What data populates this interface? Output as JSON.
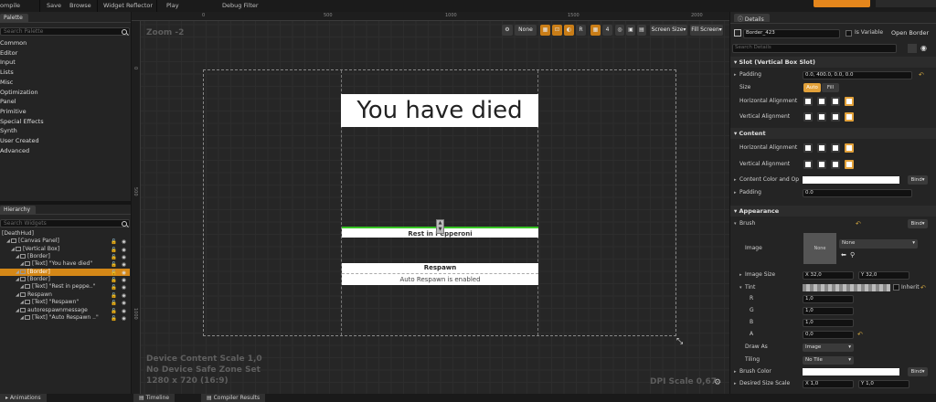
{
  "toolbar": {
    "items": [
      "ompile",
      "Save",
      "Browse",
      "Widget Reflector",
      "Play",
      "Debug Filter"
    ]
  },
  "palette": {
    "tab": "Palette",
    "search_placeholder": "Search Palette",
    "categories": [
      "Common",
      "Editor",
      "Input",
      "Lists",
      "Misc",
      "Optimization",
      "Panel",
      "Primitive",
      "Special Effects",
      "Synth",
      "User Created",
      "Advanced"
    ]
  },
  "hierarchy": {
    "tab": "Hierarchy",
    "search_placeholder": "Search Widgets",
    "items": [
      {
        "label": "[DeathHud]",
        "indent": 0,
        "selected": false
      },
      {
        "label": "[Canvas Panel]",
        "indent": 1,
        "selected": false
      },
      {
        "label": "[Vertical Box]",
        "indent": 2,
        "selected": false
      },
      {
        "label": "[Border]",
        "indent": 3,
        "selected": false
      },
      {
        "label": "[Text] \"You have died\"",
        "indent": 4,
        "selected": false
      },
      {
        "label": "[Border]",
        "indent": 3,
        "selected": true
      },
      {
        "label": "[Border]",
        "indent": 3,
        "selected": false
      },
      {
        "label": "[Text] \"Rest in peppe..\"",
        "indent": 4,
        "selected": false
      },
      {
        "label": "Respawn",
        "indent": 3,
        "selected": false
      },
      {
        "label": "[Text] \"Respawn\"",
        "indent": 4,
        "selected": false
      },
      {
        "label": "autorespawnmessage",
        "indent": 3,
        "selected": false
      },
      {
        "label": "[Text] \"Auto Respawn ..\"",
        "indent": 4,
        "selected": false
      }
    ]
  },
  "designer": {
    "zoom": "Zoom -2",
    "ruler_top": [
      "0",
      "500",
      "1000",
      "1500",
      "2000"
    ],
    "ruler_left": [
      "0",
      "500",
      "1000"
    ],
    "tools": {
      "none_label": "None",
      "r_label": "R",
      "grid_value": "4",
      "screen_size": "Screen Size",
      "fill_screen": "Fill Screen"
    },
    "died_text": "You have died",
    "rip_text": "Rest in Pepperoni",
    "respawn_text": "Respawn",
    "auto_respawn_text": "Auto Respawn is enabled",
    "info_lines": [
      "Device Content Scale 1,0",
      "No Device Safe Zone Set",
      "1280 x 720 (16:9)"
    ],
    "dpi": "DPI Scale 0,67"
  },
  "details": {
    "tab": "Details",
    "name_value": "Border_423",
    "is_variable": "Is Variable",
    "open_border": "Open Border",
    "search_placeholder": "Search Details",
    "slot_section": "Slot (Vertical Box Slot)",
    "padding_label": "Padding",
    "padding_value": "0.0, 400.0, 0.0, 0.0",
    "size_label": "Size",
    "size_auto": "Auto",
    "size_fill": "Fill",
    "h_align_label": "Horizontal Alignment",
    "v_align_label": "Vertical Alignment",
    "content_section": "Content",
    "content_h_align": "Horizontal Alignment",
    "content_v_align": "Vertical Alignment",
    "content_color_label": "Content Color and Op",
    "bind": "Bind",
    "content_padding_label": "Padding",
    "content_padding_value": "0.0",
    "appearance_section": "Appearance",
    "brush_label": "Brush",
    "image_label": "Image",
    "image_thumb": "None",
    "image_value": "None",
    "image_size_label": "Image Size",
    "image_size_x": "32,0",
    "image_size_y": "32,0",
    "tint_label": "Tint",
    "inherit": "Inherit",
    "r_label": "R",
    "g_label": "G",
    "b_label": "B",
    "a_label": "A",
    "r_value": "1,0",
    "g_value": "1,0",
    "b_value": "1,0",
    "a_value": "0,0",
    "draw_as_label": "Draw As",
    "draw_as_value": "Image",
    "tiling_label": "Tiling",
    "tiling_value": "No Tile",
    "brush_color_label": "Brush Color",
    "desired_size_label": "Desired Size Scale",
    "desired_x": "1,0",
    "desired_y": "1,0"
  },
  "bottom_tabs": [
    "Animations",
    "Timeline",
    "Compiler Results"
  ]
}
